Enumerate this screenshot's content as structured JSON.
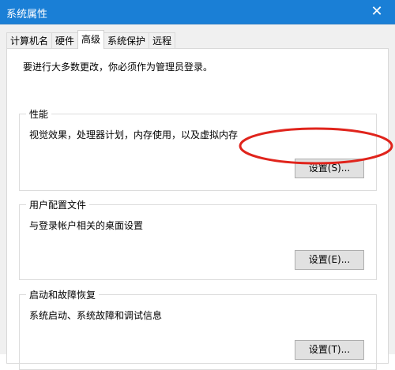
{
  "window": {
    "title": "系统属性",
    "close_label": "✕"
  },
  "tabs": [
    {
      "label": "计算机名",
      "active": false
    },
    {
      "label": "硬件",
      "active": false
    },
    {
      "label": "高级",
      "active": true
    },
    {
      "label": "系统保护",
      "active": false
    },
    {
      "label": "远程",
      "active": false
    }
  ],
  "advanced": {
    "intro": "要进行大多数更改，你必须作为管理员登录。",
    "performance": {
      "title": "性能",
      "description": "视觉效果，处理器计划，内存使用，以及虚拟内存",
      "button": "设置(S)..."
    },
    "user_profiles": {
      "title": "用户配置文件",
      "description": "与登录帐户相关的桌面设置",
      "button": "设置(E)..."
    },
    "startup_recovery": {
      "title": "启动和故障恢复",
      "description": "系统启动、系统故障和调试信息",
      "button": "设置(T)..."
    }
  },
  "annotation": {
    "color": "#e0241c",
    "shape": "ellipse"
  }
}
